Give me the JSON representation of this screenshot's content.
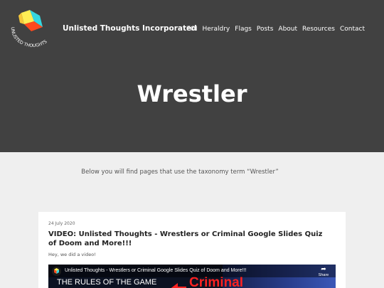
{
  "site": {
    "logo_text": "UNLISTED THOUGHTS",
    "name": "Unlisted Thoughts Incorporated"
  },
  "nav": [
    "FOI",
    "Heraldry",
    "Flags",
    "Posts",
    "About",
    "Resources",
    "Contact"
  ],
  "page": {
    "title": "Wrestler",
    "intro": "Below you will find pages that use the taxonomy term “Wrestler”"
  },
  "post": {
    "date": "24 July 2020",
    "title": "VIDEO: Unlisted Thoughts - Wrestlers or Criminal Google Slides Quiz of Doom and More!!!",
    "excerpt": "Hey, we did a video!",
    "video": {
      "title": "Unlisted Thoughts - Wrestlers or Criminal Google Slides Quiz of Doom and More!!!",
      "share_label": "Share",
      "overlay_left": "THE RULES OF THE GAME",
      "overlay_right": "Criminal"
    }
  },
  "colors": {
    "hero_bg": "#414141",
    "page_bg": "#efefef",
    "logo_yellow": "#ffee55",
    "logo_cyan": "#34d6e0",
    "logo_red": "#ff4a1c"
  },
  "icons": {
    "share": "share-arrow-icon",
    "logo": "cube-logo-icon"
  }
}
